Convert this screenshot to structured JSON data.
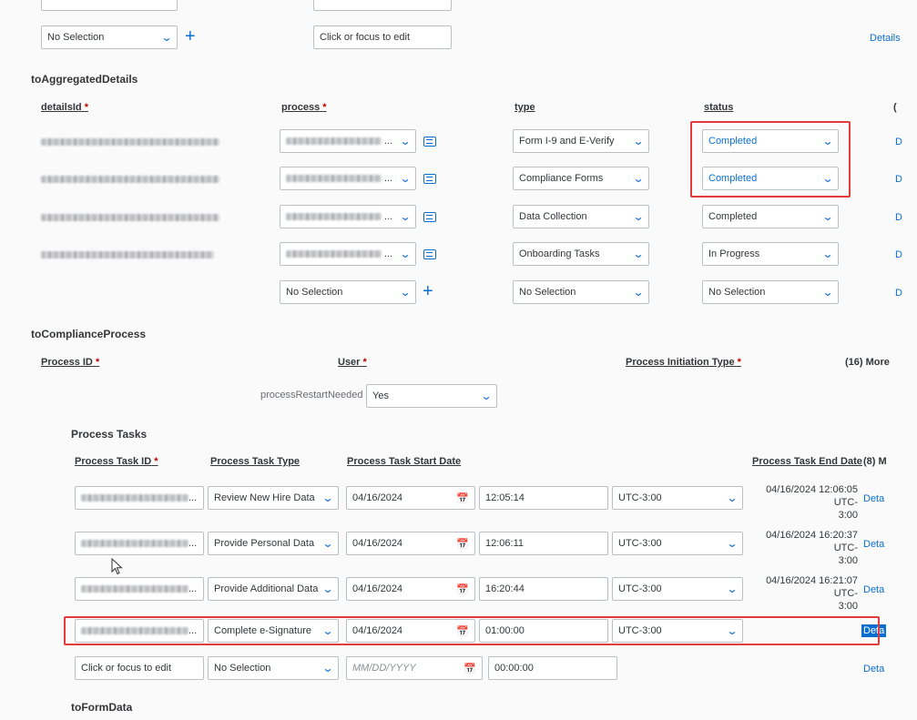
{
  "top": {
    "no_selection": "No Selection",
    "click_to_edit": "Click or focus to edit",
    "details_link": "Details"
  },
  "agg": {
    "title": "toAggregatedDetails",
    "headers": {
      "detailsId": "detailsId",
      "process": "process",
      "type": "type",
      "status": "status",
      "required_mark": "*",
      "more": "("
    },
    "rows": [
      {
        "type": "Form I-9 and E-Verify",
        "status": "Completed",
        "link": "D"
      },
      {
        "type": "Compliance Forms",
        "status": "Completed",
        "link": "D"
      },
      {
        "type": "Data Collection",
        "status": "Completed",
        "link": "D"
      },
      {
        "type": "Onboarding Tasks",
        "status": "In Progress",
        "link": "D"
      },
      {
        "process": "No Selection",
        "type": "No Selection",
        "status": "No Selection",
        "link": "D"
      }
    ]
  },
  "compliance": {
    "title": "toComplianceProcess",
    "headers": {
      "process_id": "Process ID",
      "user": "User",
      "init_type": "Process Initiation Type",
      "more": "(16) More",
      "required_mark": "*"
    }
  },
  "restart": {
    "label": "processRestartNeeded",
    "value": "Yes"
  },
  "tasks": {
    "title": "Process Tasks",
    "headers": {
      "id": "Process Task ID",
      "type": "Process Task Type",
      "start": "Process Task Start Date",
      "end": "Process Task End Date",
      "more": "(8) M",
      "required_mark": "*"
    },
    "rows": [
      {
        "type": "Review New Hire Data",
        "date": "04/16/2024",
        "time": "12:05:14",
        "tz": "UTC-3:00",
        "end1": "04/16/2024 12:06:05 UTC-",
        "end2": "3:00",
        "link": "Deta"
      },
      {
        "type": "Provide Personal Data",
        "date": "04/16/2024",
        "time": "12:06:11",
        "tz": "UTC-3:00",
        "end1": "04/16/2024 16:20:37 UTC-",
        "end2": "3:00",
        "link": "Deta"
      },
      {
        "type": "Provide Additional Data",
        "date": "04/16/2024",
        "time": "16:20:44",
        "tz": "UTC-3:00",
        "end1": "04/16/2024 16:21:07 UTC-",
        "end2": "3:00",
        "link": "Deta"
      },
      {
        "type": "Complete e-Signature",
        "date": "04/16/2024",
        "time": "01:00:00",
        "tz": "UTC-3:00",
        "end1": "",
        "end2": "",
        "link": "Deta"
      }
    ],
    "new_row": {
      "id_placeholder": "Click or focus to edit",
      "type": "No Selection",
      "date_placeholder": "MM/DD/YYYY",
      "time": "00:00:00",
      "link": "Deta"
    }
  },
  "form": {
    "title": "toFormData"
  },
  "icons": {
    "dropdown": "chevron-down-icon",
    "add": "plus-icon",
    "calendar": "calendar-icon",
    "value_help": "value-help-icon",
    "cursor": "mouse-pointer-icon"
  },
  "colors": {
    "accent": "#0a6ed1",
    "highlight_border": "#e23b3b",
    "selected_link_bg": "#0a6ed1"
  }
}
